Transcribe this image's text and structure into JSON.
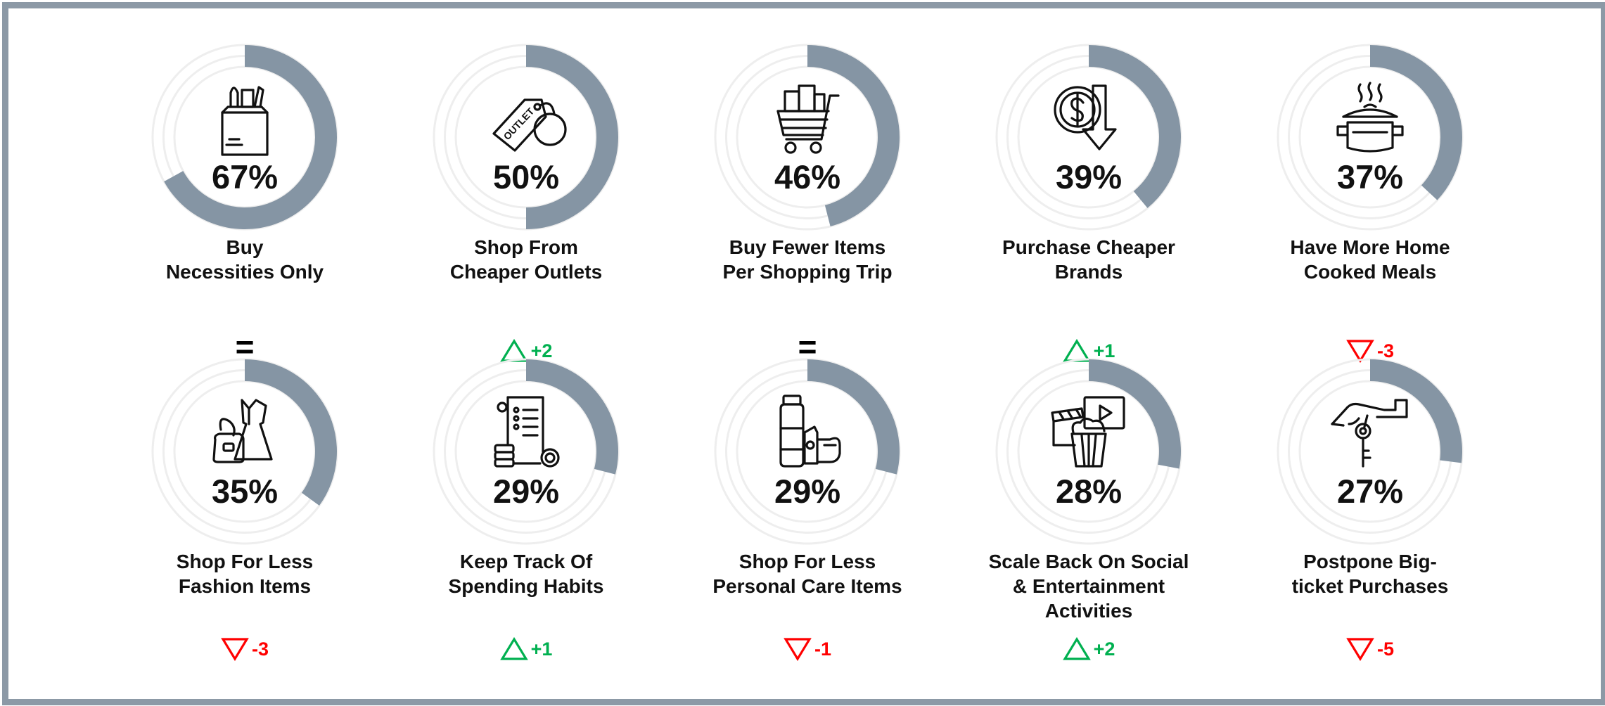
{
  "colors": {
    "ring_fill": "#8595a4",
    "ring_track": "#eeeeee",
    "up": "#00b050",
    "down": "#ff0000",
    "frame": "#8c99a6"
  },
  "chart_data": {
    "type": "donut",
    "items": [
      {
        "label": "Buy\nNecessities Only",
        "value": 67,
        "display": "67%",
        "change": "=",
        "trend": "same",
        "icon": "grocery-bag-icon"
      },
      {
        "label": "Shop From\nCheaper Outlets",
        "value": 50,
        "display": "50%",
        "change": "+2",
        "trend": "up",
        "icon": "outlet-tag-icon"
      },
      {
        "label": "Buy Fewer Items\nPer Shopping Trip",
        "value": 46,
        "display": "46%",
        "change": "=",
        "trend": "same",
        "icon": "shopping-cart-icon"
      },
      {
        "label": "Purchase Cheaper\nBrands",
        "value": 39,
        "display": "39%",
        "change": "+1",
        "trend": "up",
        "icon": "dollar-down-arrow-icon"
      },
      {
        "label": "Have More Home\nCooked Meals",
        "value": 37,
        "display": "37%",
        "change": "-3",
        "trend": "down",
        "icon": "cooking-pot-icon"
      },
      {
        "label": "Shop For Less\nFashion Items",
        "value": 35,
        "display": "35%",
        "change": "-3",
        "trend": "down",
        "icon": "dress-handbag-icon"
      },
      {
        "label": "Keep Track Of\nSpending Habits",
        "value": 29,
        "display": "29%",
        "change": "+1",
        "trend": "up",
        "icon": "receipt-coins-icon"
      },
      {
        "label": "Shop For Less\nPersonal Care Items",
        "value": 29,
        "display": "29%",
        "change": "-1",
        "trend": "down",
        "icon": "personal-care-bottles-icon"
      },
      {
        "label": "Scale Back On Social\n&  Entertainment\nActivities",
        "value": 28,
        "display": "28%",
        "change": "+2",
        "trend": "up",
        "icon": "popcorn-movie-icon"
      },
      {
        "label": "Postpone Big-\nticket Purchases",
        "value": 27,
        "display": "27%",
        "change": "-5",
        "trend": "down",
        "icon": "hand-key-icon"
      }
    ]
  }
}
